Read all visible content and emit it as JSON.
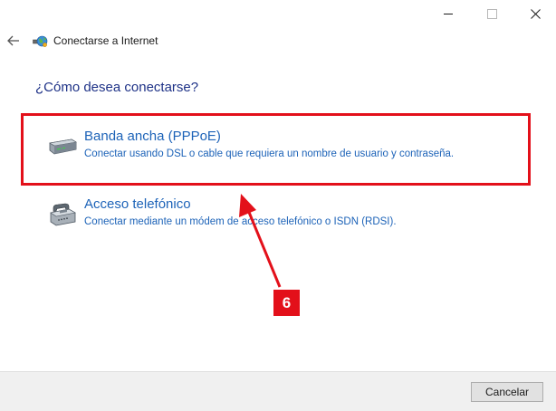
{
  "window": {
    "title": "Conectarse a Internet",
    "controls": {
      "minimize": "minimize-icon",
      "maximize": "maximize-icon",
      "close": "close-icon"
    }
  },
  "nav": {
    "back_icon": "back-arrow-icon",
    "app_icon": "network-globe-icon"
  },
  "main": {
    "heading": "¿Cómo desea conectarse?",
    "options": [
      {
        "title": "Banda ancha (PPPoE)",
        "description": "Conectar usando DSL o cable que requiera un nombre de usuario y contraseña.",
        "icon": "broadband-modem-icon"
      },
      {
        "title": "Acceso telefónico",
        "description": "Conectar mediante un módem de acceso telefónico o ISDN (RDSI).",
        "icon": "dialup-phone-icon"
      }
    ]
  },
  "annotation": {
    "step_number": "6",
    "color": "#e3101a"
  },
  "footer": {
    "cancel_label": "Cancelar"
  },
  "colors": {
    "heading": "#1e3287",
    "link": "#1d63b8",
    "footer_bg": "#f0f0f0"
  }
}
